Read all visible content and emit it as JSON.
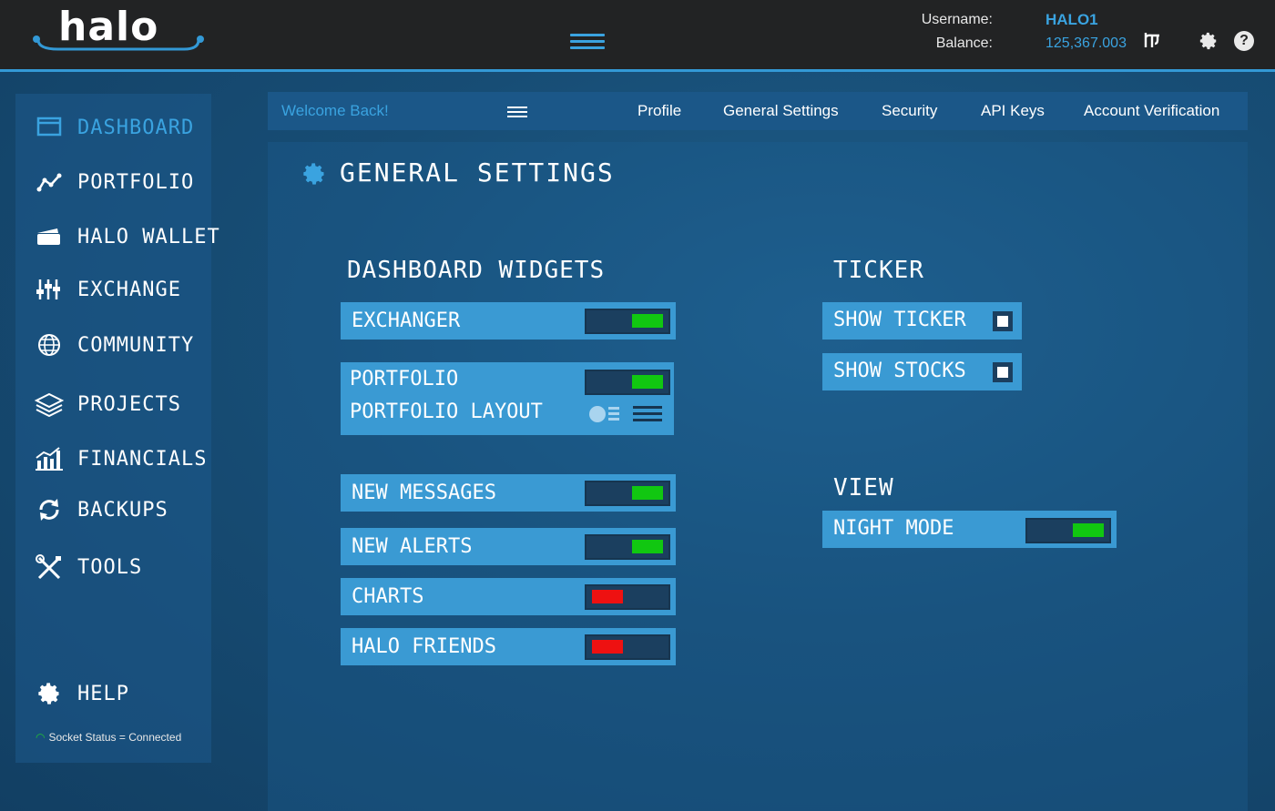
{
  "header": {
    "logo_text": "halo",
    "username_label": "Username:",
    "balance_label": "Balance:",
    "username": "HALO1",
    "balance": "125,367.003",
    "currency_icon": "halo-coin-icon",
    "settings_icon": "gear-icon",
    "help_icon": "help-icon",
    "help_glyph": "?",
    "accent_color": "#3aa3e0"
  },
  "sidebar": {
    "items": [
      {
        "label": "DASHBOARD",
        "icon": "dashboard-window-icon",
        "active": true
      },
      {
        "label": "PORTFOLIO",
        "icon": "chart-line-icon"
      },
      {
        "label": "HALO WALLET",
        "icon": "wallet-icon"
      },
      {
        "label": "EXCHANGE",
        "icon": "sliders-icon"
      },
      {
        "label": "COMMUNITY",
        "icon": "globe-icon"
      },
      {
        "label": "PROJECTS",
        "icon": "layers-icon"
      },
      {
        "label": "FINANCIALS",
        "icon": "bar-chart-icon"
      },
      {
        "label": "BACKUPS",
        "icon": "refresh-icon"
      },
      {
        "label": "TOOLS",
        "icon": "tools-icon"
      }
    ],
    "help_label": "HELP",
    "socket_status": "Socket Status = Connected"
  },
  "subnav": {
    "welcome": "Welcome Back!",
    "tabs": [
      "Profile",
      "General Settings",
      "Security",
      "API Keys",
      "Account Verification"
    ]
  },
  "page": {
    "title": "GENERAL SETTINGS"
  },
  "widgets": {
    "heading": "DASHBOARD WIDGETS",
    "exchanger": {
      "label": "EXCHANGER",
      "on": true
    },
    "portfolio": {
      "label": "PORTFOLIO",
      "on": true
    },
    "portfolio_layout": {
      "label": "PORTFOLIO LAYOUT"
    },
    "new_messages": {
      "label": "NEW MESSAGES",
      "on": true
    },
    "new_alerts": {
      "label": "NEW ALERTS",
      "on": true
    },
    "charts": {
      "label": "CHARTS",
      "on": false
    },
    "halo_friends": {
      "label": "HALO FRIENDS",
      "on": false
    }
  },
  "ticker": {
    "heading": "TICKER",
    "show_ticker": {
      "label": "SHOW TICKER",
      "checked": false
    },
    "show_stocks": {
      "label": "SHOW STOCKS",
      "checked": false
    }
  },
  "view": {
    "heading": "VIEW",
    "night_mode": {
      "label": "NIGHT MODE",
      "on": true
    }
  },
  "colors": {
    "toggle_on": "#11c711",
    "toggle_off": "#ee1111",
    "row_bg": "#3a9ad3"
  }
}
